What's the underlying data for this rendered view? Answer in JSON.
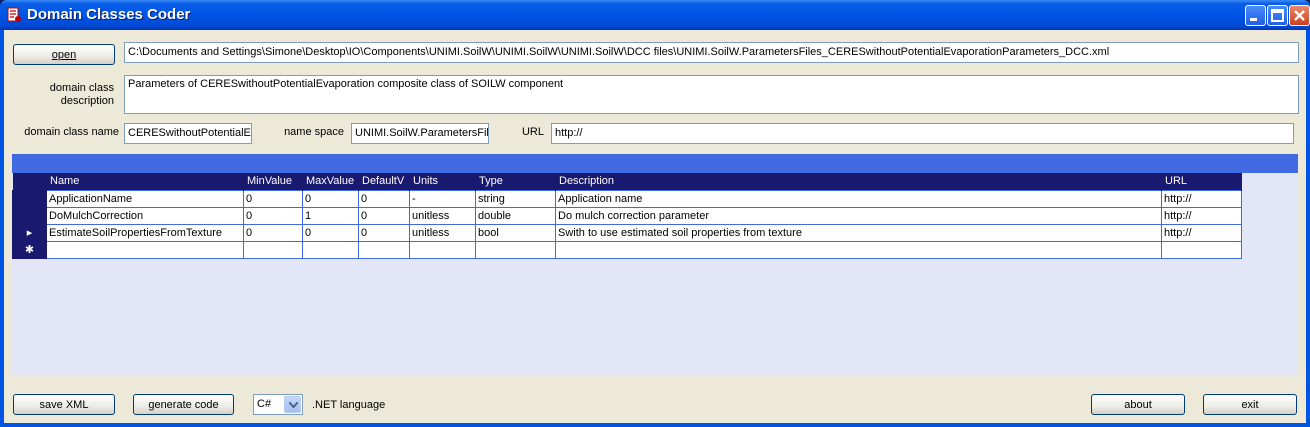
{
  "window": {
    "title": "Domain Classes Coder"
  },
  "file": {
    "open_label": "open",
    "path": "C:\\Documents and Settings\\Simone\\Desktop\\IO\\Components\\UNIMI.SoilW\\UNIMI.SoilW\\UNIMI.SoilW\\DCC files\\UNIMI.SoilW.ParametersFiles_CERESwithoutPotentialEvaporationParameters_DCC.xml"
  },
  "description": {
    "label_line1": "domain class",
    "label_line2": "description",
    "value": "Parameters of CERESwithoutPotentialEvaporation composite class of SOILW component"
  },
  "meta": {
    "class_name_label": "domain class name",
    "class_name_value": "CERESwithoutPotentialE",
    "namespace_label": "name space",
    "namespace_value": "UNIMI.SoilW.ParametersFil",
    "url_label": "URL",
    "url_value": "http://"
  },
  "grid": {
    "columns": [
      "Name",
      "MinValue",
      "MaxValue",
      "DefaultV",
      "Units",
      "Type",
      "Description",
      "URL"
    ],
    "rows": [
      {
        "indicator": "",
        "cells": [
          "ApplicationName",
          "0",
          "0",
          "0",
          "-",
          "string",
          "Application name",
          "http://"
        ]
      },
      {
        "indicator": "",
        "cells": [
          "DoMulchCorrection",
          "0",
          "1",
          "0",
          "unitless",
          "double",
          "Do mulch correction parameter",
          "http://"
        ]
      },
      {
        "indicator": "▸",
        "cells": [
          "EstimateSoilPropertiesFromTexture",
          "0",
          "0",
          "0",
          "unitless",
          "bool",
          "Swith to use estimated soil properties from texture",
          "http://"
        ]
      },
      {
        "indicator": "✱",
        "cells": [
          "",
          "",
          "",
          "",
          "",
          "",
          "",
          ""
        ]
      }
    ]
  },
  "bottom": {
    "save_xml_label": "save XML",
    "generate_code_label": "generate code",
    "language_value": "C#",
    "language_label": ".NET language",
    "about_label": "about",
    "exit_label": "exit"
  },
  "colors": {
    "title_bar": "#0055e5",
    "grid_caption": "#4169e1",
    "grid_header": "#191970",
    "grid_background": "#e2e6f6",
    "client_background": "#ece9d8"
  }
}
